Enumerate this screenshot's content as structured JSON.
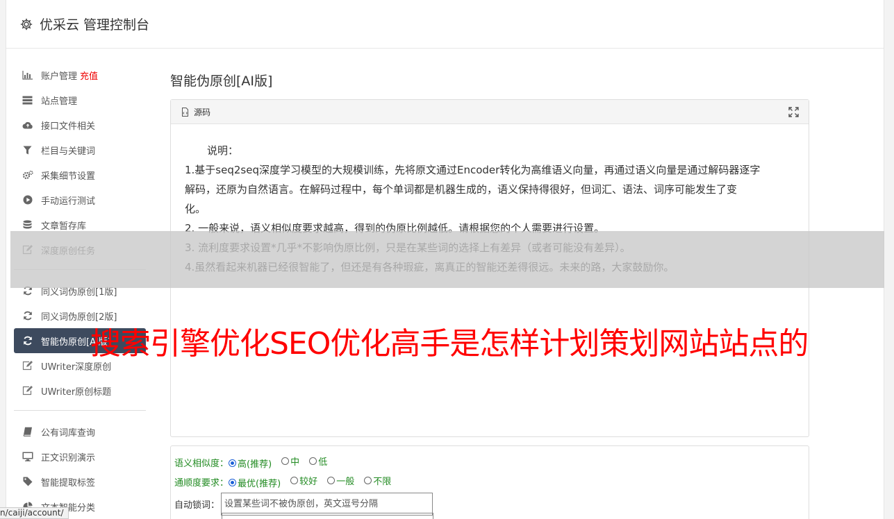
{
  "topbar": {
    "title": "优采云 管理控制台",
    "icon": "gear-icon"
  },
  "sidebar": {
    "group1": [
      {
        "label": "账户管理",
        "badge": "充值",
        "icon": "bar-chart-icon"
      },
      {
        "label": "站点管理",
        "icon": "server-icon"
      },
      {
        "label": "接口文件相关",
        "icon": "cloud-upload-icon"
      },
      {
        "label": "栏目与关键词",
        "icon": "filter-icon"
      },
      {
        "label": "采集细节设置",
        "icon": "cogs-icon"
      },
      {
        "label": "手动运行测试",
        "icon": "play-circle-icon"
      },
      {
        "label": "文章暂存库",
        "icon": "database-icon"
      },
      {
        "label": "深度原创任务",
        "icon": "edit-icon"
      }
    ],
    "group2": [
      {
        "label": "同义词伪原创[1版]",
        "icon": "refresh-icon"
      },
      {
        "label": "同义词伪原创[2版]",
        "icon": "refresh-icon"
      },
      {
        "label": "智能伪原创[AI版]",
        "icon": "refresh-icon",
        "active": true
      },
      {
        "label": "UWriter深度原创",
        "icon": "edit-icon"
      },
      {
        "label": "UWriter原创标题",
        "icon": "edit-icon"
      }
    ],
    "group3": [
      {
        "label": "公有词库查询",
        "icon": "book-icon"
      },
      {
        "label": "正文识别演示",
        "icon": "desktop-icon"
      },
      {
        "label": "智能提取标签",
        "icon": "tag-icon"
      },
      {
        "label": "文本智能分类",
        "icon": "pie-chart-icon"
      }
    ]
  },
  "main": {
    "title": "智能伪原创[AI版]",
    "panel": {
      "header": "源码",
      "heading": "说明：",
      "lines": [
        "1.基于seq2seq深度学习模型的大规模训练，先将原文通过Encoder转化为高维语义向量，再通过语义向量是通过解码器逐字",
        "解码，还原为自然语言。在解码过程中，每个单词都是机器生成的，语义保持得很好，但词汇、语法、词序可能发生了变",
        "化。",
        "2. 一般来说，语义相似度要求越高，得到的伪原比例越低。请根据您的个人需要进行设置。",
        "3. 流利度要求设置*几乎*不影响伪原比例，只是在某些词的选择上有差异（或者可能没有差异）。",
        "4.虽然看起来机器已经很智能了，但还是有各种瑕疵，离真正的智能还差得很远。未来的路，大家鼓励你。"
      ]
    },
    "options": {
      "similarity": {
        "label": "语义相似度：",
        "choices": [
          "高(推荐)",
          "中",
          "低"
        ],
        "selected": 0
      },
      "fluency": {
        "label": "通顺度要求：",
        "choices": [
          "最优(推荐)",
          "较好",
          "一般",
          "不限"
        ],
        "selected": 0
      },
      "lock": {
        "label": "自动锁词：",
        "placeholder": "设置某些词不被伪原创，英文逗号分隔"
      }
    }
  },
  "overlay": {
    "watermark": "搜索引擎优化SEO优化高手是怎样计划策划网站站点的"
  },
  "statusbar": {
    "url": "n/caiji/account/"
  },
  "colors": {
    "accent": "#3d4a5e",
    "recharge": "#ee0000",
    "option_text": "#228b22",
    "watermark": "#ff0000"
  }
}
